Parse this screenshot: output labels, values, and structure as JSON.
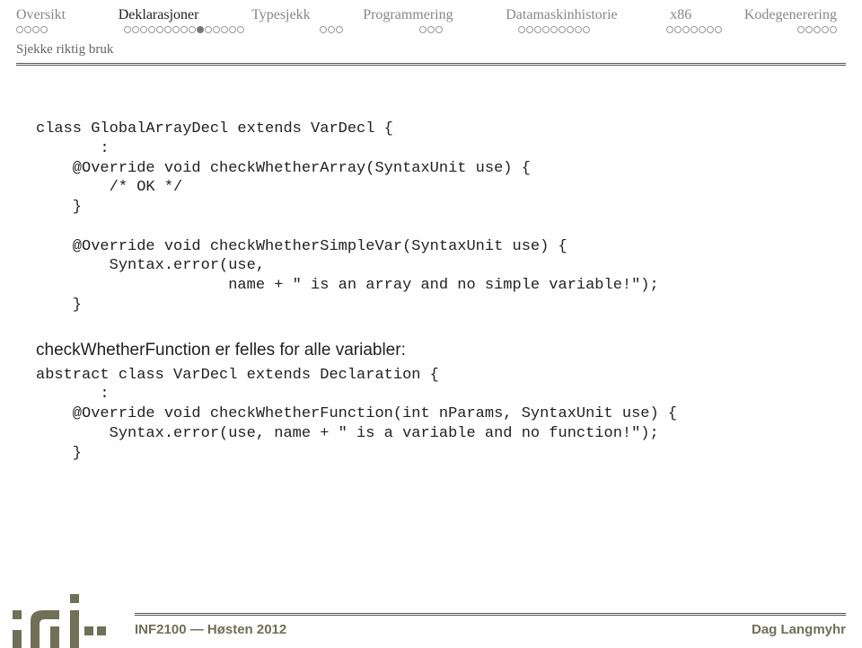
{
  "nav": {
    "tabs": [
      {
        "label": "Oversikt",
        "active": false,
        "pips": 4,
        "filled": []
      },
      {
        "label": "Deklarasjoner",
        "active": true,
        "pips": 15,
        "filled": [
          9
        ]
      },
      {
        "label": "Typesjekk",
        "active": false,
        "pips": 3,
        "filled": []
      },
      {
        "label": "Programmering",
        "active": false,
        "pips": 3,
        "filled": []
      },
      {
        "label": "Datamaskinhistorie",
        "active": false,
        "pips": 9,
        "filled": []
      },
      {
        "label": "x86",
        "active": false,
        "pips": 7,
        "filled": []
      },
      {
        "label": "Kodegenerering",
        "active": false,
        "pips": 5,
        "filled": []
      }
    ],
    "section": "Sjekke riktig bruk"
  },
  "code1": "class GlobalArrayDecl extends VarDecl {\n       :\n    @Override void checkWhetherArray(SyntaxUnit use) {\n        /* OK */\n    }\n\n    @Override void checkWhetherSimpleVar(SyntaxUnit use) {\n        Syntax.error(use,\n                     name + \" is an array and no simple variable!\");\n    }",
  "description": "checkWhetherFunction er felles for alle variabler:",
  "code2": "abstract class VarDecl extends Declaration {\n       :\n    @Override void checkWhetherFunction(int nParams, SyntaxUnit use) {\n        Syntax.error(use, name + \" is a variable and no function!\");\n    }",
  "footer": {
    "left": "INF2100 — Høsten 2012",
    "right": "Dag Langmyhr"
  }
}
